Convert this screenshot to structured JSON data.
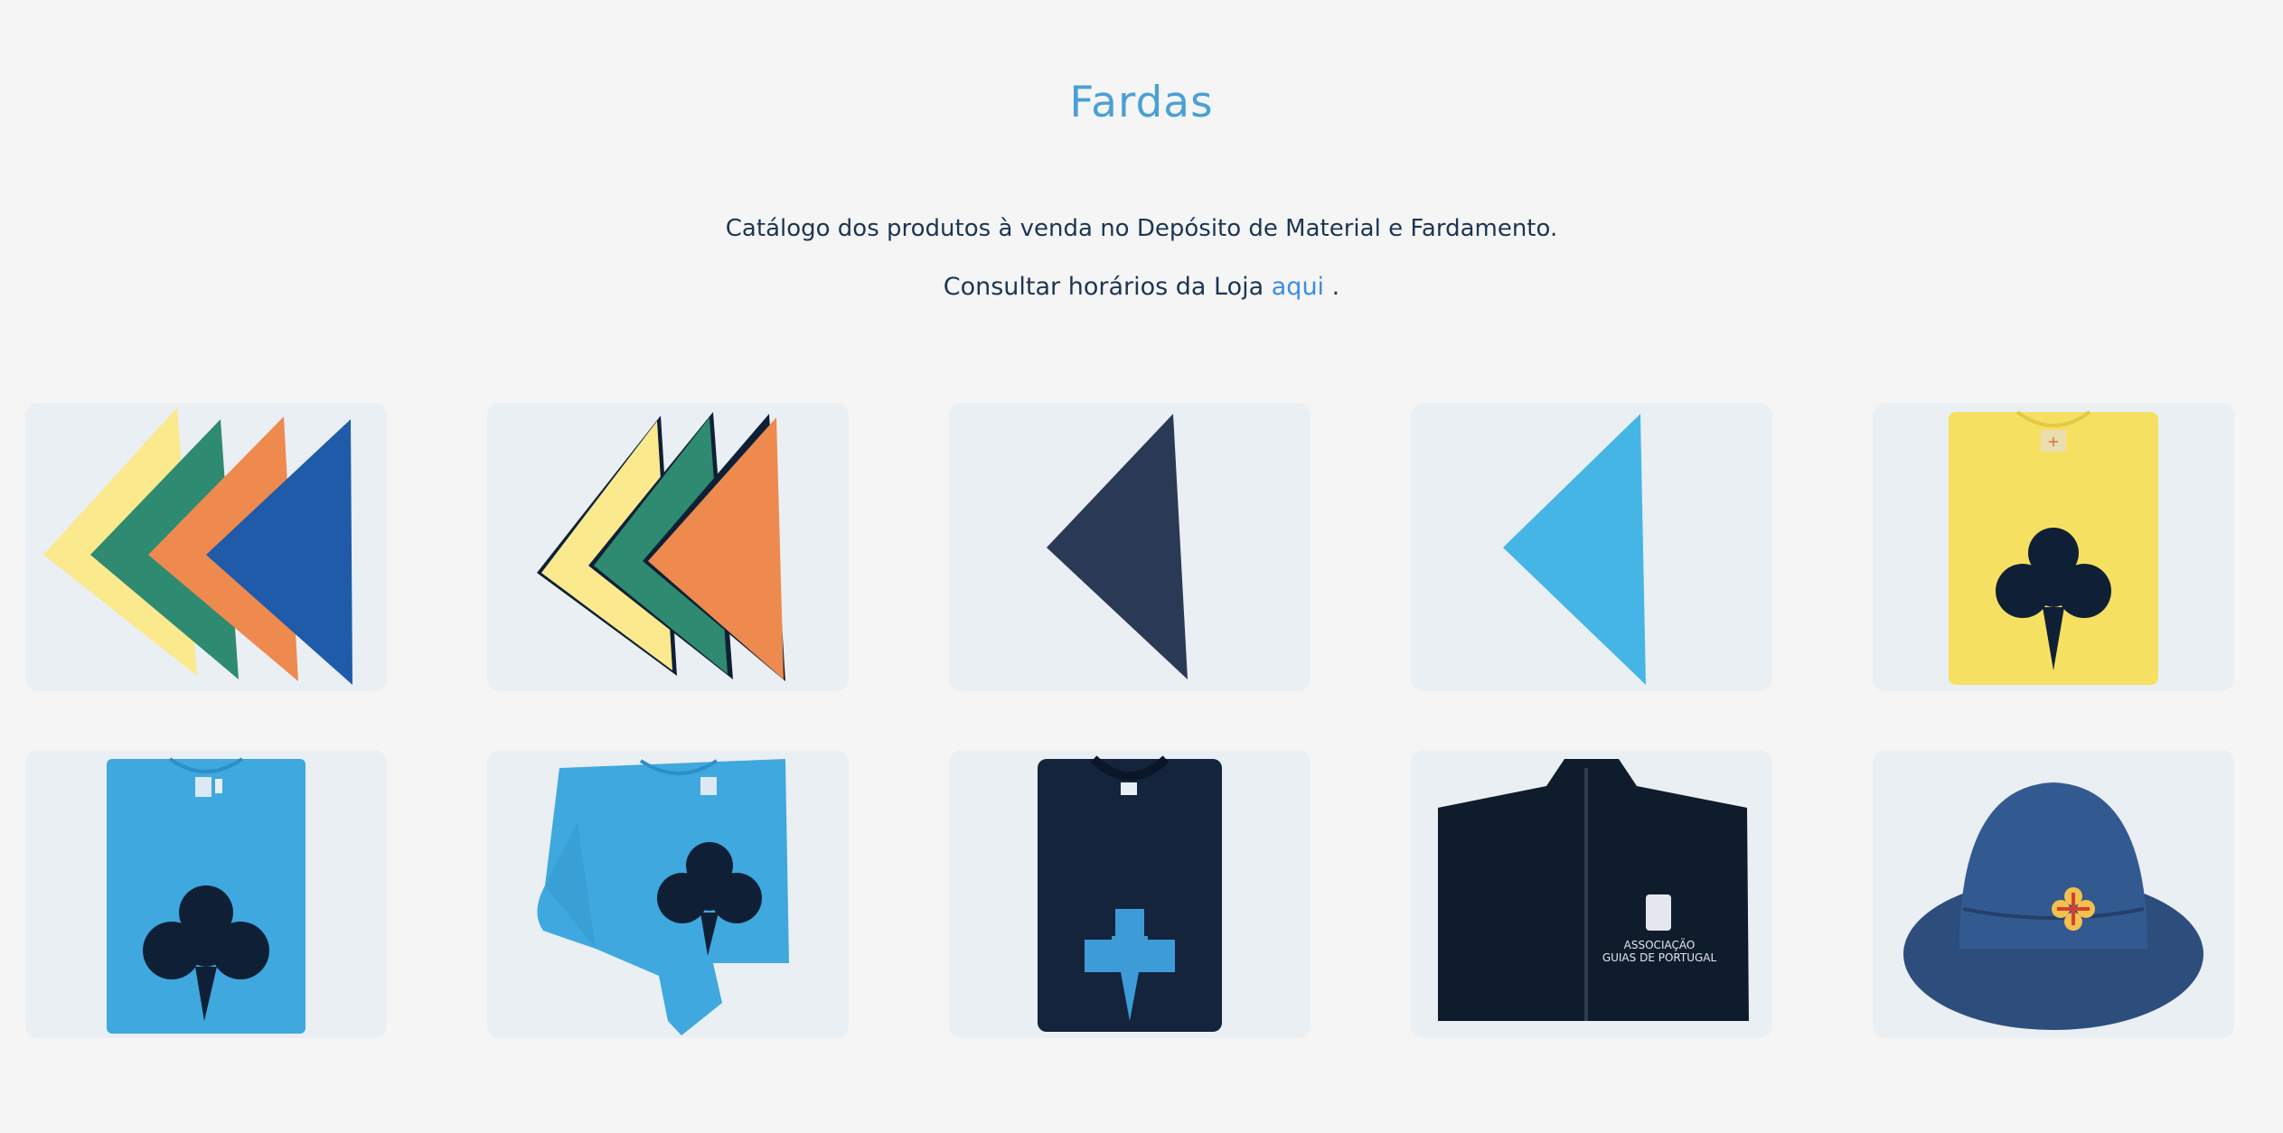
{
  "page": {
    "title": "Fardas",
    "intro": "Catálogo dos produtos à venda no Depósito de Material e Fardamento.",
    "hours_prefix": "Consultar horários da Loja",
    "hours_link": "aqui",
    "hours_suffix": " ."
  },
  "colors": {
    "title": "#4aa0d5",
    "text": "#1c3553",
    "link": "#3a8fe0",
    "card_bg": "#eaeff4",
    "navy": "#0f2036",
    "yellow": "#fbe98e",
    "green": "#2e8a70",
    "orange": "#ee8a4e",
    "blue": "#1f5ba9",
    "light_blue": "#45b5e6"
  },
  "products": [
    {
      "name": "neckerchief-set-four-colors-icon"
    },
    {
      "name": "neckerchief-set-navy-edged-icon"
    },
    {
      "name": "neckerchief-navy-icon"
    },
    {
      "name": "neckerchief-light-blue-icon"
    },
    {
      "name": "yellow-tshirt-trefoil-icon"
    },
    {
      "name": "blue-tshirt-trefoil-icon"
    },
    {
      "name": "blue-sweatshirt-trefoil-icon"
    },
    {
      "name": "navy-sweater-trefoil-icon"
    },
    {
      "name": "navy-fleece-jacket-icon"
    },
    {
      "name": "navy-bucket-hat-icon"
    }
  ],
  "fleece_print": {
    "line1": "ASSOCIAÇÃO",
    "line2": "GUIAS DE PORTUGAL"
  }
}
